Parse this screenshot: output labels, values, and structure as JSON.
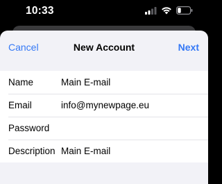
{
  "status_bar": {
    "time": "10:33"
  },
  "nav": {
    "cancel": "Cancel",
    "title": "New Account",
    "next": "Next"
  },
  "form": {
    "rows": [
      {
        "label": "Name",
        "value": "Main E-mail"
      },
      {
        "label": "Email",
        "value": "info@mynewpage.eu"
      },
      {
        "label": "Password",
        "value": ""
      },
      {
        "label": "Description",
        "value": "Main E-mail"
      }
    ]
  },
  "colors": {
    "accent": "#3478f6",
    "sheet_background": "#f2f2f7"
  },
  "icons": [
    "cellular-signal-icon",
    "wifi-icon",
    "battery-icon"
  ]
}
